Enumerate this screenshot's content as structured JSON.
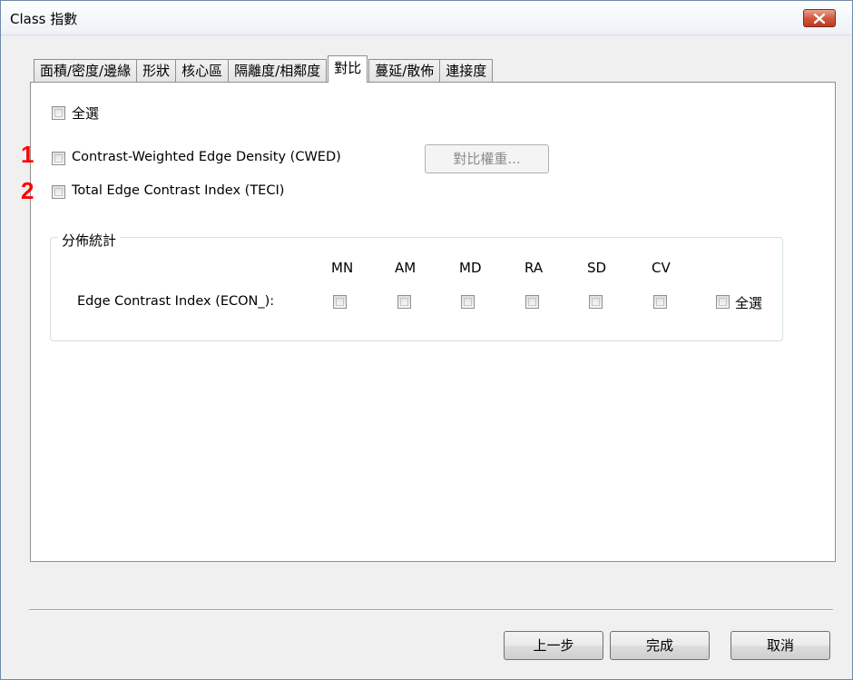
{
  "window": {
    "title": "Class 指數"
  },
  "tabs": [
    {
      "label": "面積/密度/邊緣"
    },
    {
      "label": "形狀"
    },
    {
      "label": "核心區"
    },
    {
      "label": "隔離度/相鄰度"
    },
    {
      "label": "對比",
      "active": true
    },
    {
      "label": "蔓延/散佈"
    },
    {
      "label": "連接度"
    }
  ],
  "contrast": {
    "select_all_label": "全選",
    "cwed_marker": "1",
    "cwed_label": "Contrast-Weighted Edge Density (CWED)",
    "weights_button": "對比權重...",
    "teci_marker": "2",
    "teci_label": "Total Edge Contrast Index (TECI)"
  },
  "distribution": {
    "title": "分佈統計",
    "columns": [
      "MN",
      "AM",
      "MD",
      "RA",
      "SD",
      "CV"
    ],
    "row_label": "Edge Contrast Index (ECON_):",
    "select_all_label": "全選"
  },
  "footer": {
    "back_label": "上一步",
    "finish_label": "完成",
    "cancel_label": "取消"
  }
}
